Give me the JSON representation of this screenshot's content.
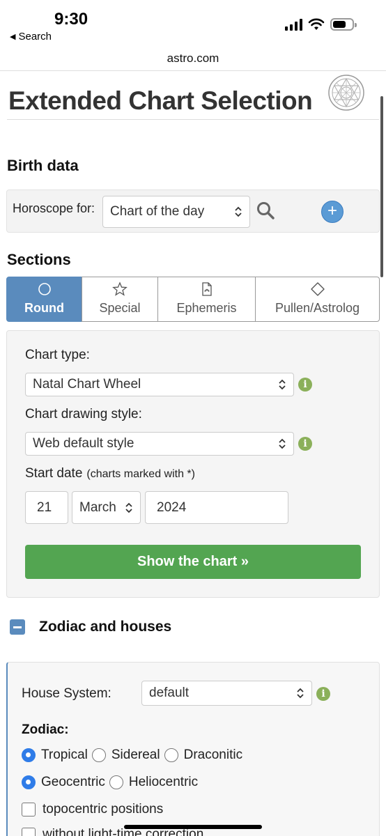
{
  "status_bar": {
    "time": "9:30",
    "back_label": "Search"
  },
  "browser": {
    "url": "astro.com"
  },
  "page": {
    "title": "Extended Chart Selection"
  },
  "birth_data": {
    "heading": "Birth data",
    "horoscope_label": "Horoscope for:",
    "horoscope_value": "Chart of the day"
  },
  "sections": {
    "heading": "Sections",
    "tabs": [
      {
        "label": "Round",
        "icon": "circle-icon",
        "active": true
      },
      {
        "label": "Special",
        "icon": "star-icon",
        "active": false
      },
      {
        "label": "Ephemeris",
        "icon": "pdf-file-icon",
        "active": false
      },
      {
        "label": "Pullen/Astrolog",
        "icon": "diamond-icon",
        "active": false
      }
    ]
  },
  "chart_settings": {
    "chart_type_label": "Chart type:",
    "chart_type_value": "Natal Chart Wheel",
    "drawing_style_label": "Chart drawing style:",
    "drawing_style_value": "Web default style",
    "start_date_label": "Start date",
    "start_date_note": "(charts marked with *)",
    "day": "21",
    "month": "March",
    "year": "2024",
    "show_button": "Show the chart »"
  },
  "zodiac_houses": {
    "heading": "Zodiac and houses",
    "house_system_label": "House System:",
    "house_system_value": "default",
    "zodiac_label": "Zodiac:",
    "zodiac_options": [
      "Tropical",
      "Sidereal",
      "Draconitic"
    ],
    "zodiac_selected": "Tropical",
    "center_options": [
      "Geocentric",
      "Heliocentric"
    ],
    "center_selected": "Geocentric",
    "topocentric_label": "topocentric positions",
    "light_time_label": "without light-time correction"
  },
  "colors": {
    "tab_active": "#5a8bbd",
    "button_green": "#53a551",
    "info_green": "#8bb05a",
    "radio_blue": "#2f7ce8"
  }
}
